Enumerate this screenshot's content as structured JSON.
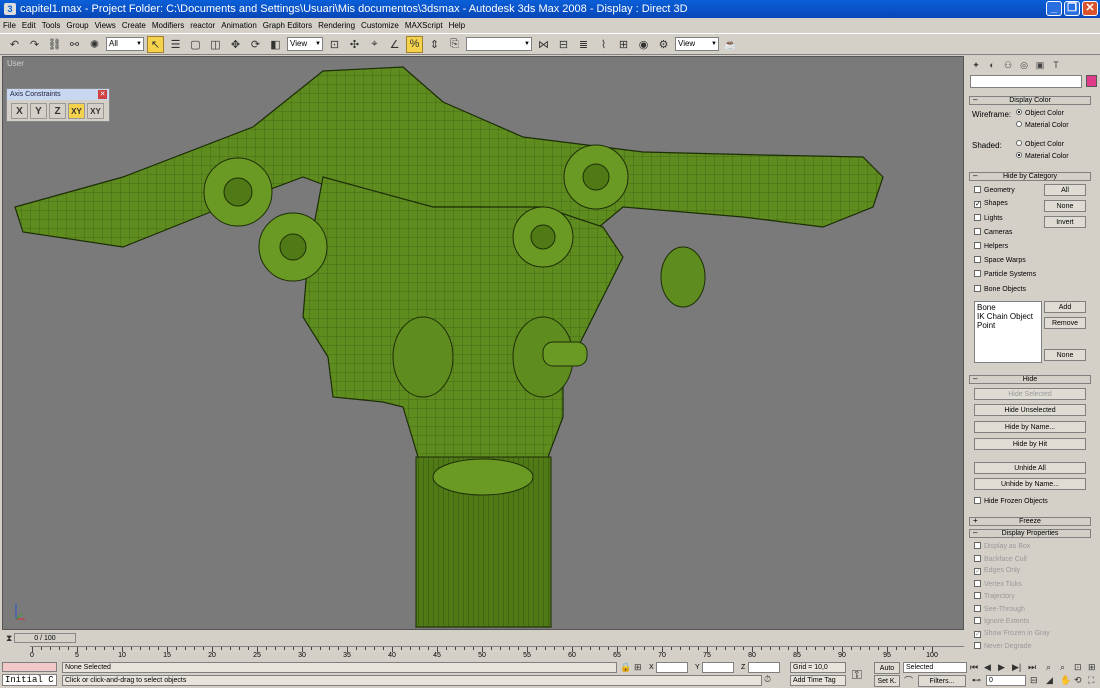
{
  "window": {
    "title": "capitel1.max      - Project Folder: C:\\Documents and Settings\\Usuari\\Mis documentos\\3dsmax      - Autodesk 3ds Max 2008      - Display : Direct 3D"
  },
  "menu": [
    "File",
    "Edit",
    "Tools",
    "Group",
    "Views",
    "Create",
    "Modifiers",
    "reactor",
    "Animation",
    "Graph Editors",
    "Rendering",
    "Customize",
    "MAXScript",
    "Help"
  ],
  "toolbar": {
    "selection_filter": "All",
    "ref_coord": "View",
    "named_selection": "",
    "view2": "View"
  },
  "viewport": {
    "label": "User",
    "model_color": "#5f8c1e"
  },
  "axis_constraints": {
    "title": "Axis Constraints",
    "buttons": [
      "X",
      "Y",
      "Z",
      "XY",
      "XY"
    ],
    "active": "XY"
  },
  "panel": {
    "display_color": {
      "header": "Display Color",
      "wireframe_label": "Wireframe:",
      "shaded_label": "Shaded:",
      "object_color": "Object Color",
      "material_color": "Material Color"
    },
    "hide_by_category": {
      "header": "Hide by Category",
      "items": [
        {
          "label": "Geometry",
          "checked": false
        },
        {
          "label": "Shapes",
          "checked": true
        },
        {
          "label": "Lights",
          "checked": false
        },
        {
          "label": "Cameras",
          "checked": false
        },
        {
          "label": "Helpers",
          "checked": false
        },
        {
          "label": "Space Warps",
          "checked": false
        },
        {
          "label": "Particle Systems",
          "checked": false
        },
        {
          "label": "Bone Objects",
          "checked": false
        }
      ],
      "btn_all": "All",
      "btn_none": "None",
      "btn_invert": "Invert",
      "list": [
        "Bone",
        "IK Chain Object",
        "Point"
      ],
      "btn_add": "Add",
      "btn_remove": "Remove",
      "btn_none2": "None"
    },
    "hide": {
      "header": "Hide",
      "hide_selected": "Hide Selected",
      "hide_unselected": "Hide Unselected",
      "hide_by_name": "Hide by Name...",
      "hide_by_hit": "Hide by Hit",
      "unhide_all": "Unhide All",
      "unhide_by_name": "Unhide by Name...",
      "hide_frozen": "Hide Frozen Objects"
    },
    "freeze": {
      "header": "Freeze"
    },
    "display_properties": {
      "header": "Display Properties",
      "items": [
        {
          "label": "Display as Box",
          "checked": false
        },
        {
          "label": "Backface Cull",
          "checked": false
        },
        {
          "label": "Edges Only",
          "checked": true
        },
        {
          "label": "Vertex Ticks",
          "checked": false
        },
        {
          "label": "Trajectory",
          "checked": false
        },
        {
          "label": "See-Through",
          "checked": false
        },
        {
          "label": "Ignore Extents",
          "checked": false
        },
        {
          "label": "Show Frozen in Gray",
          "checked": true
        },
        {
          "label": "Never Degrade",
          "checked": false
        }
      ]
    }
  },
  "timeline": {
    "slider": "0 / 100",
    "ticks": [
      "0",
      "5",
      "10",
      "15",
      "20",
      "25",
      "30",
      "35",
      "40",
      "45",
      "50",
      "55",
      "60",
      "65",
      "70",
      "75",
      "80",
      "85",
      "90",
      "95",
      "100"
    ]
  },
  "status": {
    "listener": "Initial C",
    "selection": "None Selected",
    "prompt": "Click or click-and-drag to select objects",
    "x_label": "X",
    "y_label": "Y",
    "z_label": "Z",
    "grid": "Grid = 10,0",
    "add_time_tag": "Add Time Tag",
    "auto": "Auto",
    "set_key": "Set K.",
    "key_filter": "Selected",
    "filters": "Filters...",
    "frame": "0"
  }
}
